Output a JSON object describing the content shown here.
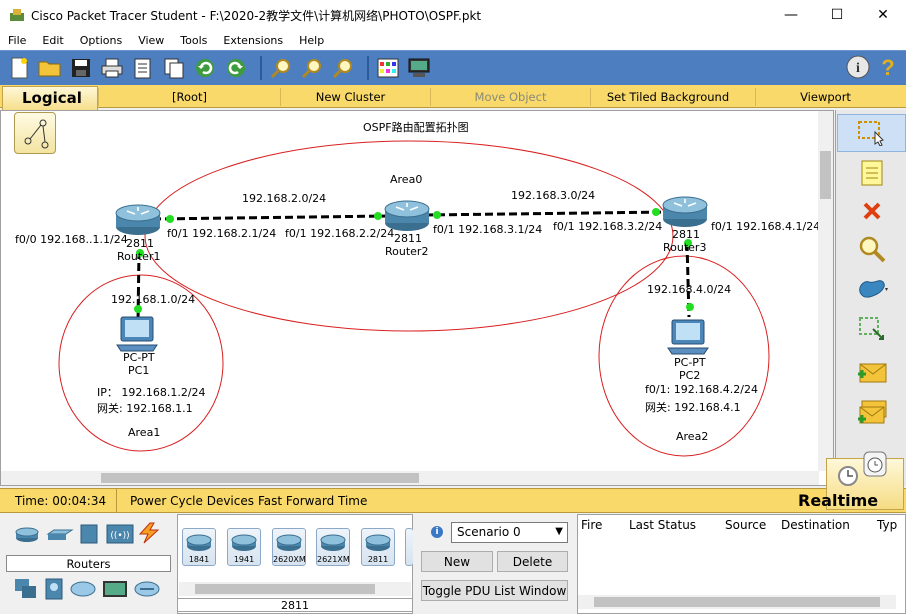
{
  "window": {
    "title": "Cisco Packet Tracer Student - F:\\2020-2教学文件\\计算机网络\\PHOTO\\OSPF.pkt",
    "minimize": "—",
    "maximize": "☐",
    "close": "✕"
  },
  "menu": [
    "File",
    "Edit",
    "Options",
    "View",
    "Tools",
    "Extensions",
    "Help"
  ],
  "toolbar": {
    "icons": [
      "new-file-icon",
      "open-folder-icon",
      "save-icon",
      "print-icon",
      "activity-wizard-icon",
      "copy-icon",
      "undo-icon",
      "redo-icon",
      "zoom-in-icon",
      "zoom-reset-icon",
      "zoom-out-icon",
      "palette-icon",
      "custom-device-icon"
    ],
    "right_icons": [
      "info-icon",
      "help-icon"
    ]
  },
  "nav": {
    "logical": "Logical",
    "root": "[Root]",
    "new_cluster": "New Cluster",
    "move_object": "Move Object",
    "set_tiled_background": "Set Tiled Background",
    "viewport": "Viewport"
  },
  "topology": {
    "title": "OSPF路由配置拓扑图",
    "areas": {
      "area0": "Area0",
      "area1": "Area1",
      "area2": "Area2"
    },
    "networks": {
      "n21": "192.168.2.0/24",
      "n31": "192.168.3.0/24",
      "n11": "192.168.1.0/24",
      "n41": "192.168.4.0/24"
    },
    "router1": {
      "model": "2811",
      "name": "Router1",
      "if_left": "f0/0 192.168..1.1/24",
      "if_right": "f0/1 192.168.2.1/24"
    },
    "router2": {
      "model": "2811",
      "name": "Router2",
      "if_left": "f0/1 192.168.2.2/24",
      "if_right": "f0/1 192.168.3.1/24"
    },
    "router3": {
      "model": "2811",
      "name": "Router3",
      "if_left": "f0/1 192.168.3.2/24",
      "if_right": "f0/1 192.168.4.1/24"
    },
    "pc1": {
      "type": "PC-PT",
      "name": "PC1",
      "ip": "IP：  192.168.1.2/24",
      "gw": "网关:  192.168.1.1"
    },
    "pc2": {
      "type": "PC-PT",
      "name": "PC2",
      "ip": "f0/1:   192.168.4.2/24",
      "gw": "网关:  192.168.4.1"
    }
  },
  "palette": [
    "select-icon",
    "note-icon",
    "delete-icon",
    "inspect-icon",
    "draw-shape-icon",
    "resize-icon",
    "add-simple-pdu-icon",
    "add-complex-pdu-icon"
  ],
  "status": {
    "time": "Time: 00:04:34",
    "power_cycle": "Power Cycle Devices",
    "fast_forward": "Fast Forward Time",
    "realtime": "Realtime"
  },
  "devices": {
    "category": "Routers",
    "models": [
      "1841",
      "1941",
      "2620XM",
      "2621XM",
      "2811"
    ],
    "selected_model": "2811"
  },
  "scenario": {
    "info": "i",
    "selected": "Scenario 0",
    "new": "New",
    "delete": "Delete",
    "toggle": "Toggle PDU List Window"
  },
  "pdu_columns": [
    "Fire",
    "Last Status",
    "Source",
    "Destination",
    "Typ"
  ]
}
